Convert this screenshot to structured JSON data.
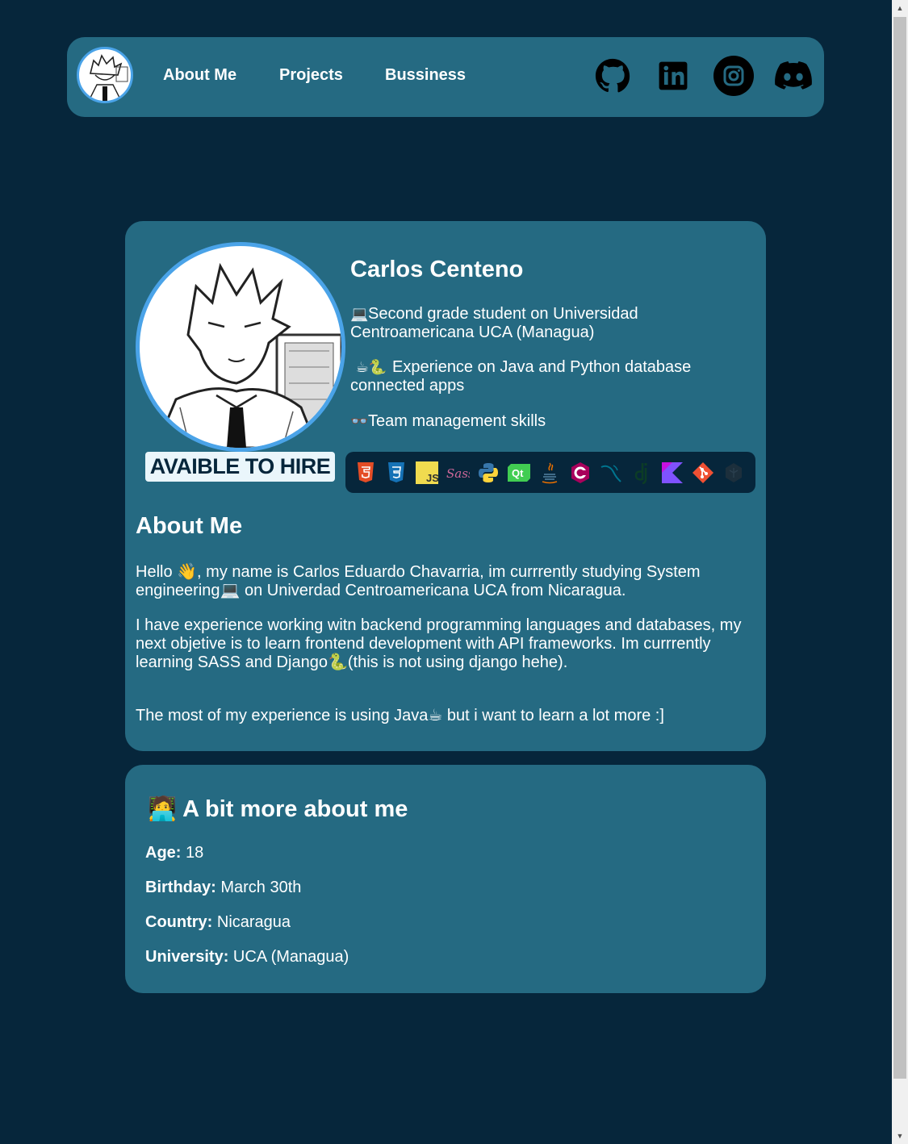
{
  "nav": {
    "links": [
      "About Me",
      "Projects",
      "Bussiness"
    ],
    "socials": [
      "github-icon",
      "linkedin-icon",
      "instagram-icon",
      "discord-icon"
    ]
  },
  "profile": {
    "name": "Carlos Centeno",
    "hire_badge": "AVAIBLE TO HIRE",
    "info": [
      {
        "emoji": "💻",
        "text": "Second grade student on Universidad Centroamericana UCA (Managua)"
      },
      {
        "emoji": "☕🐍",
        "text": "Experience on Java and Python database connected apps"
      },
      {
        "emoji": "👓",
        "text": "Team management skills"
      }
    ],
    "skills": [
      "html5-icon",
      "css3-icon",
      "js-icon",
      "sass-icon",
      "python-icon",
      "qt-icon",
      "java-icon",
      "csharp-icon",
      "mysql-icon",
      "django-icon",
      "kotlin-icon",
      "git-icon",
      "unity-icon"
    ]
  },
  "about": {
    "title": "About Me",
    "p1_a": "Hello",
    "p1_emoji1": "👋",
    "p1_b": ", my name is Carlos Eduardo Chavarria, im currrently studying System engineering",
    "p1_emoji2": "💻",
    "p1_c": " on Univerdad Centroamericana UCA from Nicaragua.",
    "p2_a": "I have experience working witn backend programming languages and databases, my next objetive is to learn frontend development with API frameworks. Im currrently learning SASS and Django",
    "p2_emoji": "🐍",
    "p2_b": "(this is not using django hehe).",
    "p3_a": "The most of my experience is using Java",
    "p3_emoji": "☕",
    "p3_b": " but i want to learn a lot more :]"
  },
  "more": {
    "emoji": "🧑‍💻",
    "title": "A bit more about me",
    "facts": [
      {
        "label": "Age:",
        "value": " 18"
      },
      {
        "label": "Birthday:",
        "value": " March 30th"
      },
      {
        "label": "Country:",
        "value": " Nicaragua"
      },
      {
        "label": "University:",
        "value": " UCA (Managua)"
      }
    ]
  }
}
